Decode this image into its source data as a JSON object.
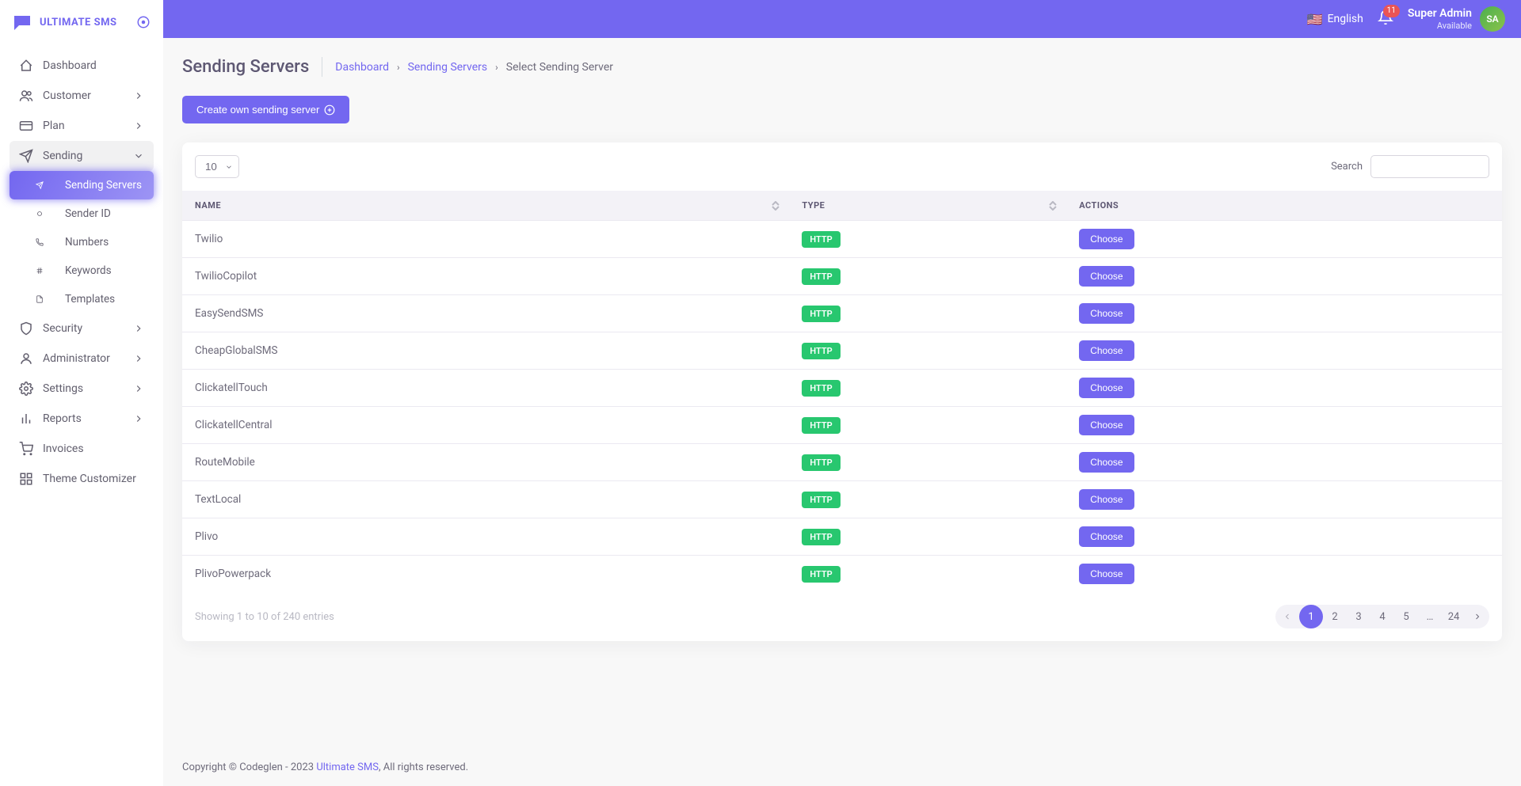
{
  "brand": "ULTIMATE SMS",
  "topbar": {
    "language": "English",
    "notif_count": "11",
    "user_name": "Super Admin",
    "user_status": "Available"
  },
  "sidebar": {
    "items": [
      {
        "icon": "home",
        "label": "Dashboard",
        "has_children": false
      },
      {
        "icon": "users",
        "label": "Customer",
        "has_children": true
      },
      {
        "icon": "credit-card",
        "label": "Plan",
        "has_children": true
      },
      {
        "icon": "send",
        "label": "Sending",
        "has_children": true,
        "expanded": true,
        "children": [
          {
            "label": "Sending Servers",
            "active": true
          },
          {
            "label": "Sender ID"
          },
          {
            "label": "Numbers"
          },
          {
            "label": "Keywords"
          },
          {
            "label": "Templates"
          }
        ]
      },
      {
        "icon": "shield",
        "label": "Security",
        "has_children": true
      },
      {
        "icon": "user",
        "label": "Administrator",
        "has_children": true
      },
      {
        "icon": "settings",
        "label": "Settings",
        "has_children": true
      },
      {
        "icon": "bar-chart",
        "label": "Reports",
        "has_children": true
      },
      {
        "icon": "shopping-cart",
        "label": "Invoices",
        "has_children": false
      },
      {
        "icon": "grid",
        "label": "Theme Customizer",
        "has_children": false
      }
    ]
  },
  "page": {
    "title": "Sending Servers",
    "breadcrumb": {
      "dashboard": "Dashboard",
      "servers": "Sending Servers",
      "current": "Select Sending Server"
    },
    "create_btn": "Create own sending server",
    "length_value": "10",
    "search_label": "Search",
    "columns": {
      "name": "Name",
      "type": "Type",
      "actions": "Actions"
    },
    "choose_label": "Choose",
    "rows": [
      {
        "name": "Twilio",
        "type": "HTTP"
      },
      {
        "name": "TwilioCopilot",
        "type": "HTTP"
      },
      {
        "name": "EasySendSMS",
        "type": "HTTP"
      },
      {
        "name": "CheapGlobalSMS",
        "type": "HTTP"
      },
      {
        "name": "ClickatellTouch",
        "type": "HTTP"
      },
      {
        "name": "ClickatellCentral",
        "type": "HTTP"
      },
      {
        "name": "RouteMobile",
        "type": "HTTP"
      },
      {
        "name": "TextLocal",
        "type": "HTTP"
      },
      {
        "name": "Plivo",
        "type": "HTTP"
      },
      {
        "name": "PlivoPowerpack",
        "type": "HTTP"
      }
    ],
    "info": "Showing 1 to 10 of 240 entries",
    "pages": [
      "1",
      "2",
      "3",
      "4",
      "5",
      "…",
      "24"
    ]
  },
  "footer": {
    "prefix": "Copyright © Codeglen - 2023 ",
    "link": "Ultimate SMS",
    "suffix": ", All rights reserved."
  }
}
